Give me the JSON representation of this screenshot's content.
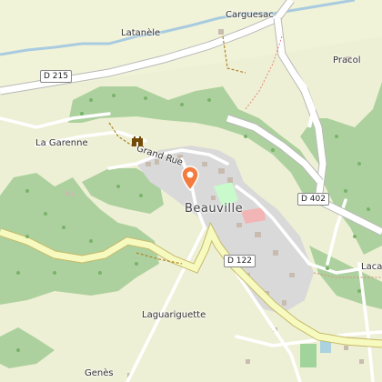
{
  "map": {
    "places": {
      "carguesac": "Carguesac",
      "latanele": "Latanèle",
      "pracol": "Pracol",
      "la_garenne": "La Garenne",
      "grand_rue": "Grand Rue",
      "beauville": "Beauville",
      "laguariguette": "Laguariguette",
      "genes": "Genès",
      "laca": "Laca"
    },
    "roads": {
      "d215": "D 215",
      "d402": "D 402",
      "d122": "D 122"
    },
    "icons": {
      "pin": "map-pin-icon",
      "castle": "castle-icon"
    },
    "colors": {
      "background": "#eef0d5",
      "forest": "#add19e",
      "urban": "#d9d9d9",
      "main_road": "#f7fabf",
      "minor_road": "#ffffff",
      "river": "#a9cbe0",
      "pin": "#f47b40",
      "park": "#c8facc"
    }
  }
}
